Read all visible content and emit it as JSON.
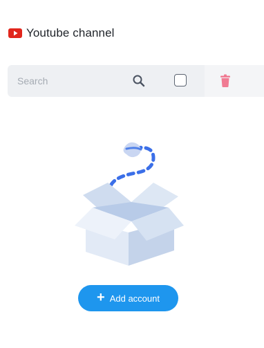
{
  "header": {
    "title": "Youtube channel",
    "icon": "youtube-icon",
    "icon_color": "#e1261c"
  },
  "toolbar": {
    "search": {
      "placeholder": "Search",
      "value": ""
    },
    "search_icon": "search-icon",
    "select_all_checked": false,
    "delete_icon": "trash-icon",
    "delete_icon_color": "#f07b93"
  },
  "empty_state": {
    "illustration": "open-box-icon",
    "accent": "#3b6fe8"
  },
  "add_button": {
    "label": "Add account",
    "icon": "plus-icon",
    "color": "#1e96ee"
  }
}
